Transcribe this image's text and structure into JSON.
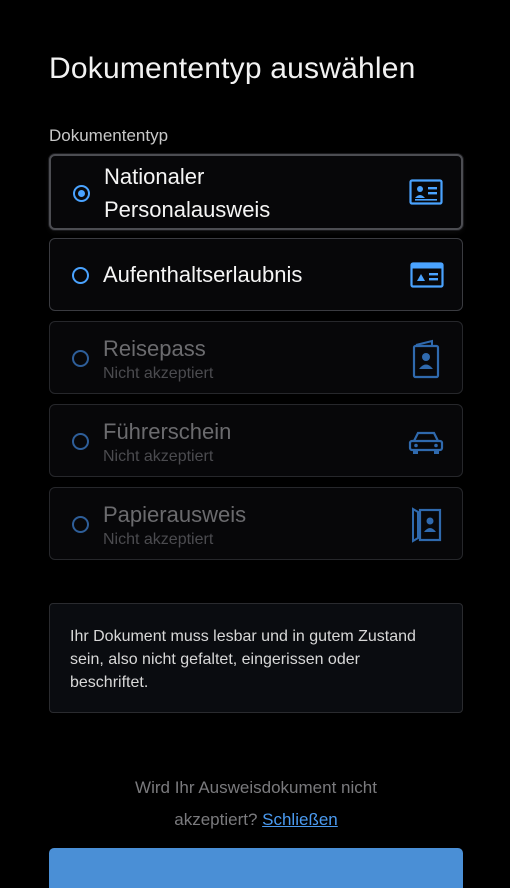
{
  "page": {
    "title": "Dokumententyp auswählen",
    "section_label": "Dokumententyp"
  },
  "options": [
    {
      "title_line1": "Nationaler",
      "title_line2": "Personalausweis",
      "subtitle": "",
      "icon": "id-card-icon",
      "state": "selected"
    },
    {
      "title": "Aufenthaltserlaubnis",
      "subtitle": "",
      "icon": "residence-permit-card-icon",
      "state": "enabled"
    },
    {
      "title": "Reisepass",
      "subtitle": "Nicht akzeptiert",
      "icon": "passport-icon",
      "state": "disabled"
    },
    {
      "title": "Führerschein",
      "subtitle": "Nicht akzeptiert",
      "icon": "car-icon",
      "state": "disabled"
    },
    {
      "title": "Papierausweis",
      "subtitle": "Nicht akzeptiert",
      "icon": "paper-id-icon",
      "state": "disabled"
    }
  ],
  "info": {
    "text": "Ihr Dokument muss lesbar und in gutem Zustand sein, also nicht gefaltet, eingerissen oder beschriftet."
  },
  "footer": {
    "line1": "Wird Ihr Ausweisdokument nicht",
    "line2_prefix": "akzeptiert? ",
    "link": "Schließen"
  },
  "colors": {
    "accent": "#4aa3ff",
    "button": "#4a8fd6",
    "background": "#000000"
  }
}
